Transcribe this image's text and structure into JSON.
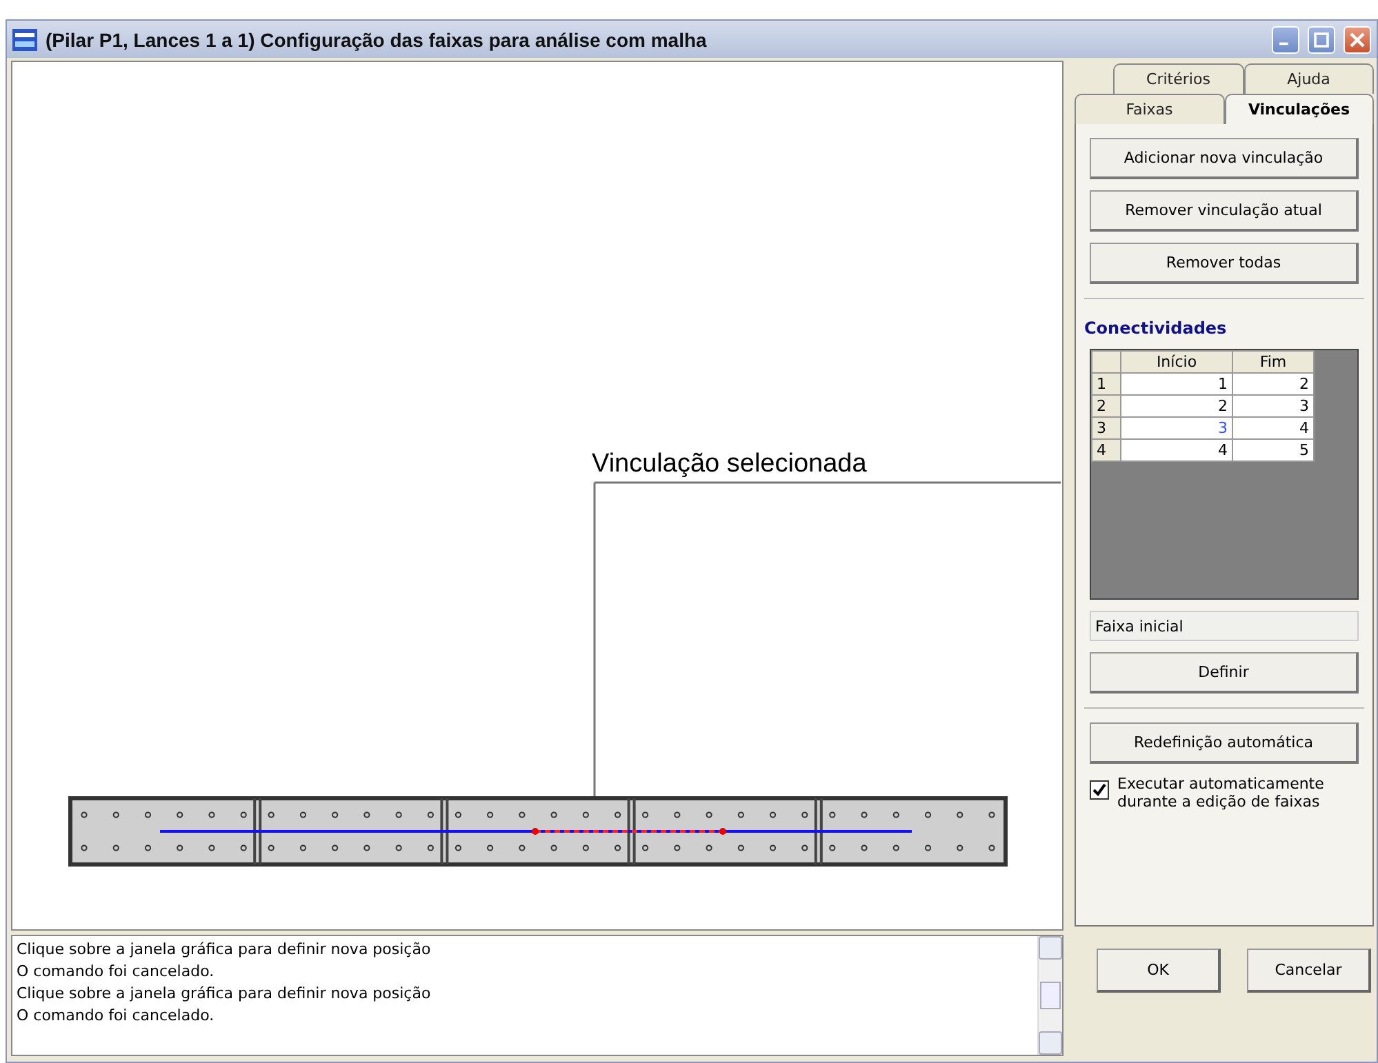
{
  "window": {
    "title": "(Pilar P1, Lances 1 a 1) Configuração das faixas para análise com malha"
  },
  "canvas": {
    "annotation": "Vinculação selecionada"
  },
  "tab_rows": [
    [
      {
        "label": "Critérios",
        "selected": false
      },
      {
        "label": "Ajuda",
        "selected": false
      }
    ],
    [
      {
        "label": "Faixas",
        "selected": false
      },
      {
        "label": "Vinculações",
        "selected": true
      }
    ]
  ],
  "top_buttons": [
    "Adicionar nova vinculação",
    "Remover vinculação atual",
    "Remover todas"
  ],
  "connectivity": {
    "title": "Conectividades",
    "columns": [
      "Início",
      "Fim"
    ],
    "rows": [
      {
        "index": "1",
        "start": "1",
        "end": "2",
        "selected": false
      },
      {
        "index": "2",
        "start": "2",
        "end": "3",
        "selected": false
      },
      {
        "index": "3",
        "start": "3",
        "end": "4",
        "selected": true
      },
      {
        "index": "4",
        "start": "4",
        "end": "5",
        "selected": false
      }
    ]
  },
  "status_field": {
    "value": "Faixa inicial"
  },
  "define_button": "Definir",
  "auto_button": "Redefinição automática",
  "auto_checkbox": {
    "label": "Executar automaticamente durante a edição de faixas",
    "checked": true
  },
  "log": [
    "Clique sobre a janela gráfica para definir nova posição",
    "O comando foi cancelado.",
    "Clique sobre a janela gráfica para definir nova posição",
    "O comando foi cancelado."
  ],
  "dialog_buttons": [
    "OK",
    "Cancelar"
  ]
}
